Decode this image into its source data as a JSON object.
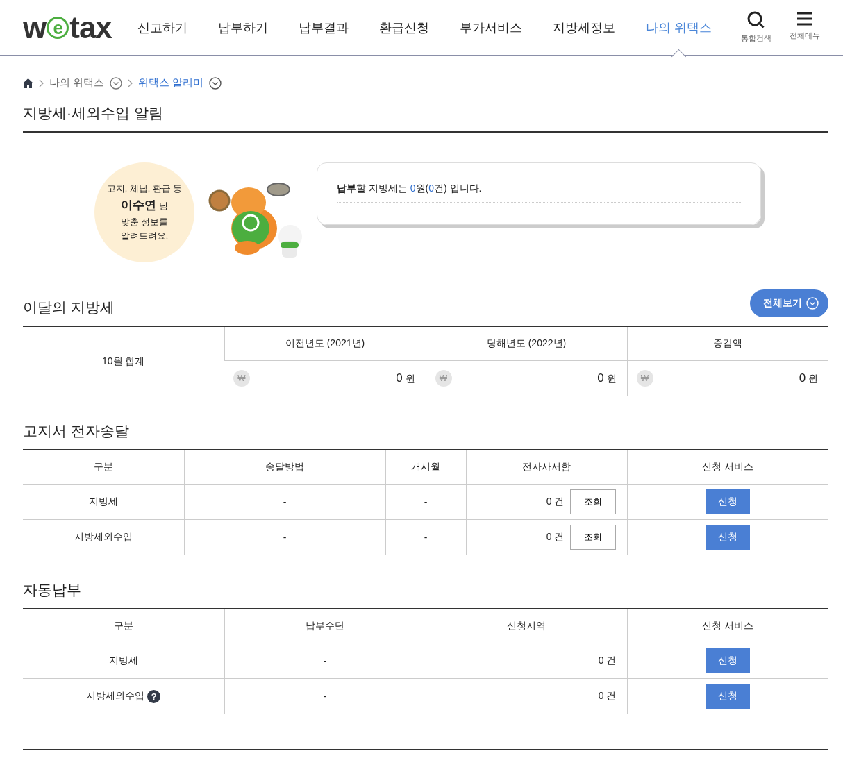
{
  "header": {
    "logo": [
      "w",
      "e",
      "tax"
    ],
    "nav": [
      {
        "label": "신고하기",
        "selected": false
      },
      {
        "label": "납부하기",
        "selected": false
      },
      {
        "label": "납부결과",
        "selected": false
      },
      {
        "label": "환급신청",
        "selected": false
      },
      {
        "label": "부가서비스",
        "selected": false
      },
      {
        "label": "지방세정보",
        "selected": false
      },
      {
        "label": "나의 위택스",
        "selected": true
      }
    ],
    "tools": [
      {
        "kind": "search",
        "label": "통합검색"
      },
      {
        "kind": "menu",
        "label": "전체메뉴"
      }
    ]
  },
  "breadcrumb": [
    {
      "label": "나의 위택스",
      "selected": false
    },
    {
      "label": "위택스 알리미",
      "selected": true
    }
  ],
  "page_title": "지방세·세외수입 알림",
  "greeting": {
    "text": "고지, 체납, 환급 등\n**이수연** 님\n맞춤 정보를\n알려드려요.",
    "message": [
      {
        "kind": "bold",
        "text": "납부"
      },
      {
        "kind": "plain",
        "text": "할 지방세는 "
      },
      {
        "kind": "highlight",
        "text": "0"
      },
      {
        "kind": "plain",
        "text": "원("
      },
      {
        "kind": "highlight",
        "text": "0"
      },
      {
        "kind": "plain",
        "text": "건) 입니다."
      }
    ]
  },
  "monthly": {
    "title": "이달의 지방세",
    "view_all": "전체보기",
    "row_label": "10월 합계",
    "columns": [
      {
        "header": "이전년도 (2021년)",
        "currency": "₩",
        "amount": "0",
        "unit": "원"
      },
      {
        "header": "당해년도 (2022년)",
        "currency": "₩",
        "amount": "0",
        "unit": "원"
      },
      {
        "header": "증감액",
        "currency": "₩",
        "amount": "0",
        "unit": "원"
      }
    ]
  },
  "notice": {
    "title": "고지서 전자송달",
    "columns": [
      "구분",
      "송달방법",
      "개시월",
      "전자사서함",
      "신청 서비스"
    ],
    "rows": [
      {
        "category": "지방세",
        "method": "-",
        "start_month": "-",
        "count": "0 건",
        "view_button": "조회",
        "apply_button": "신청"
      },
      {
        "category": "지방세외수입",
        "method": "-",
        "start_month": "-",
        "count": "0 건",
        "view_button": "조회",
        "apply_button": "신청"
      }
    ]
  },
  "autopay": {
    "title": "자동납부",
    "columns": [
      "구분",
      "납부수단",
      "신청지역",
      "신청 서비스"
    ],
    "rows": [
      {
        "category": "지방세",
        "means": "-",
        "count": "0 건",
        "apply_button": "신청"
      },
      {
        "category": "지방세외수입",
        "help": "?",
        "means": "-",
        "count": "0 건",
        "apply_button": "신청"
      }
    ]
  }
}
